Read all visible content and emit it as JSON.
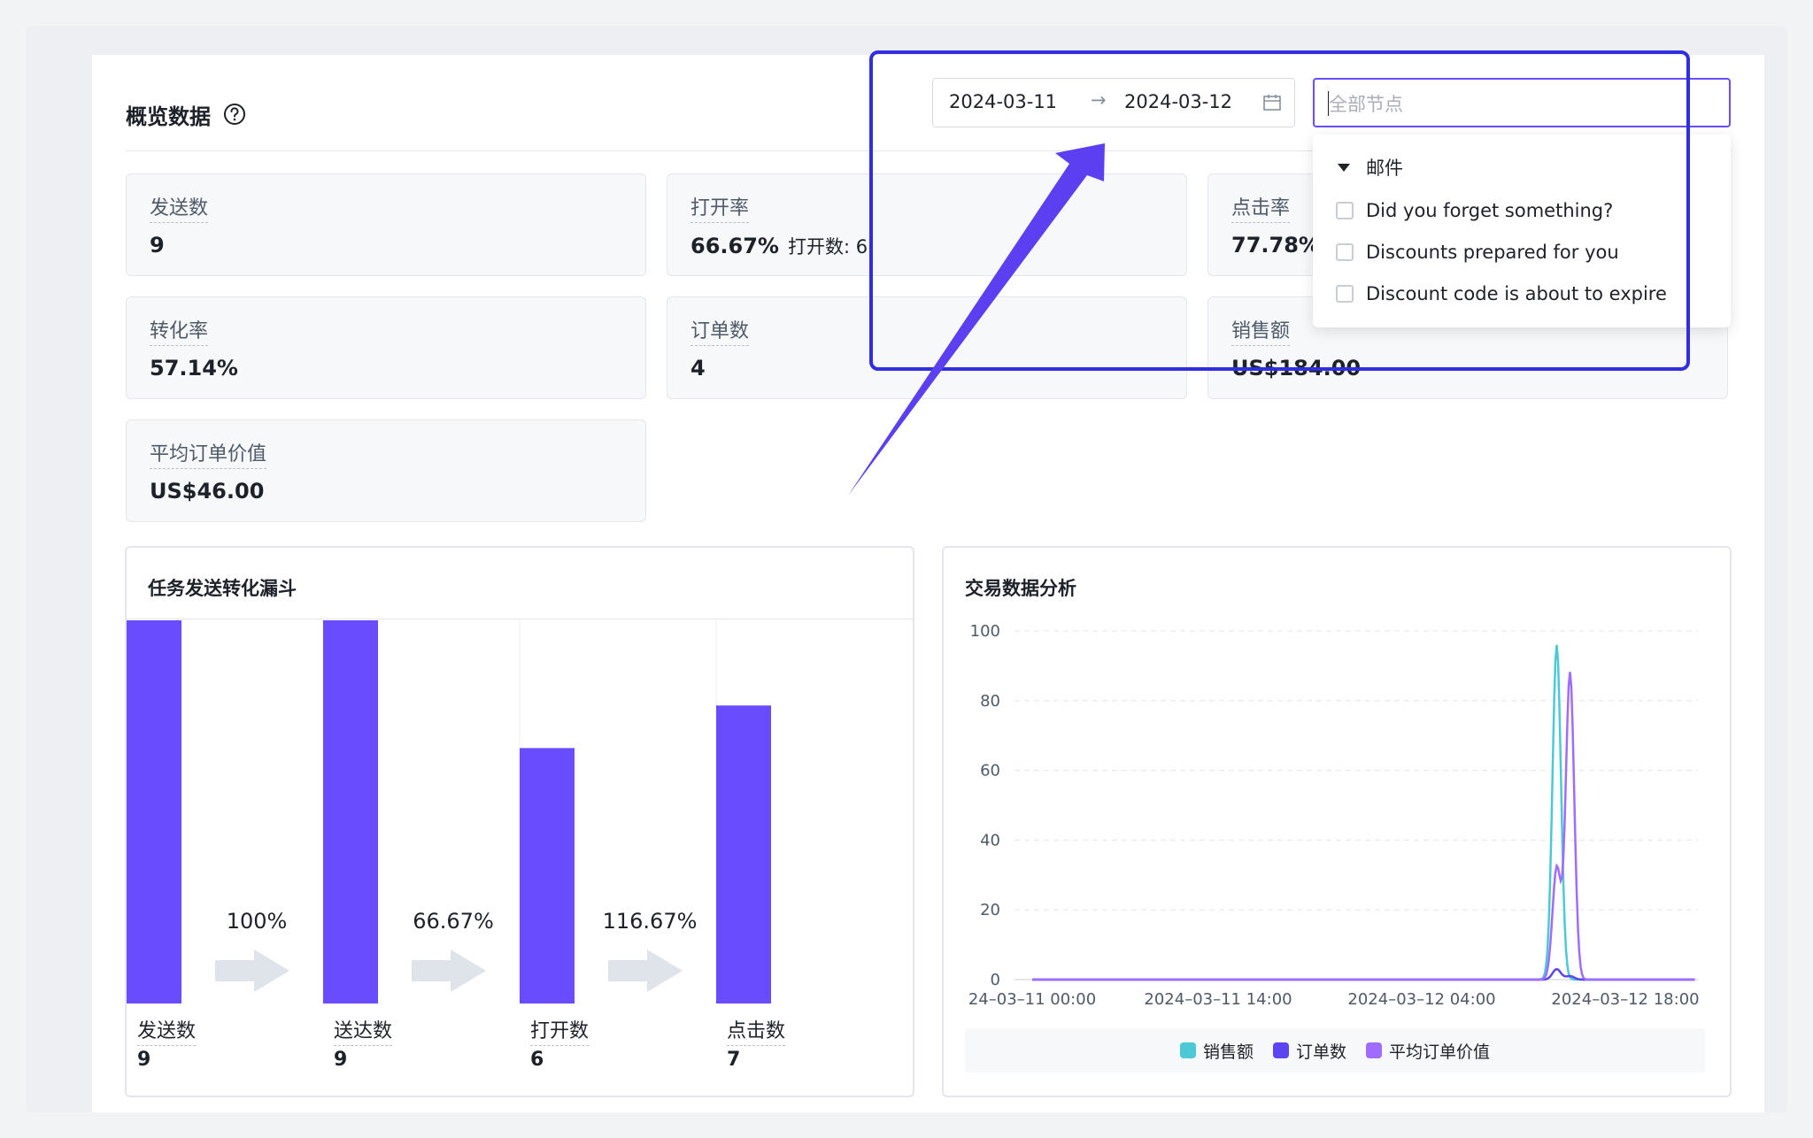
{
  "header": {
    "title": "概览数据",
    "help_icon": "question-circle-icon"
  },
  "metrics": [
    {
      "label": "发送数",
      "value": "9",
      "sub": ""
    },
    {
      "label": "打开率",
      "value": "66.67%",
      "sub": "打开数: 6"
    },
    {
      "label": "点击率",
      "value": "77.78%",
      "sub": ""
    },
    {
      "label": "转化率",
      "value": "57.14%",
      "sub": ""
    },
    {
      "label": "订单数",
      "value": "4",
      "sub": ""
    },
    {
      "label": "销售额",
      "value": "US$184.00",
      "sub": ""
    },
    {
      "label": "平均订单价值",
      "value": "US$46.00",
      "sub": ""
    }
  ],
  "date_range": {
    "start": "2024-03-11",
    "separator": "→",
    "end": "2024-03-12",
    "calendar_icon": "calendar-icon"
  },
  "node_select": {
    "placeholder": "全部节点",
    "group": "邮件",
    "options": [
      "Did you forget something?",
      "Discounts prepared for you",
      "Discount code is about to expire"
    ]
  },
  "funnel": {
    "title": "任务发送转化漏斗",
    "stages": [
      {
        "label": "发送数",
        "value": 9
      },
      {
        "label": "送达数",
        "value": 9
      },
      {
        "label": "打开数",
        "value": 6
      },
      {
        "label": "点击数",
        "value": 7
      }
    ],
    "rates": [
      "100%",
      "66.67%",
      "116.67%"
    ],
    "bar_color": "#6a4cff",
    "arrow_color": "#dfe3ea"
  },
  "trade": {
    "title": "交易数据分析",
    "y_ticks": [
      "100",
      "80",
      "60",
      "40",
      "20",
      "0"
    ],
    "x_ticks": [
      "24–03–11 00:00",
      "2024–03–11 14:00",
      "2024–03–12 04:00",
      "2024–03–12 18:00"
    ],
    "legend": [
      {
        "name": "销售额",
        "color": "#4cc9d6"
      },
      {
        "name": "订单数",
        "color": "#5b44f2"
      },
      {
        "name": "平均订单价值",
        "color": "#a06bff"
      }
    ]
  },
  "chart_data": [
    {
      "type": "bar",
      "title": "任务发送转化漏斗",
      "categories": [
        "发送数",
        "送达数",
        "打开数",
        "点击数"
      ],
      "values": [
        9,
        9,
        6,
        7
      ],
      "annotations": [
        "100%",
        "66.67%",
        "116.67%"
      ],
      "ylim": [
        0,
        9
      ]
    },
    {
      "type": "line",
      "title": "交易数据分析",
      "x": [
        "2024-03-11 00:00",
        "2024-03-11 14:00",
        "2024-03-12 04:00",
        "2024-03-12 15:30",
        "2024-03-12 16:30",
        "2024-03-12 18:00"
      ],
      "series": [
        {
          "name": "销售额",
          "values": [
            0,
            0,
            0,
            96,
            0,
            0
          ]
        },
        {
          "name": "订单数",
          "values": [
            0,
            0,
            0,
            3,
            1,
            0
          ]
        },
        {
          "name": "平均订单价值",
          "values": [
            0,
            0,
            0,
            32,
            88,
            0
          ]
        }
      ],
      "ylim": [
        0,
        100
      ],
      "grid": true,
      "legend_position": "bottom"
    }
  ]
}
